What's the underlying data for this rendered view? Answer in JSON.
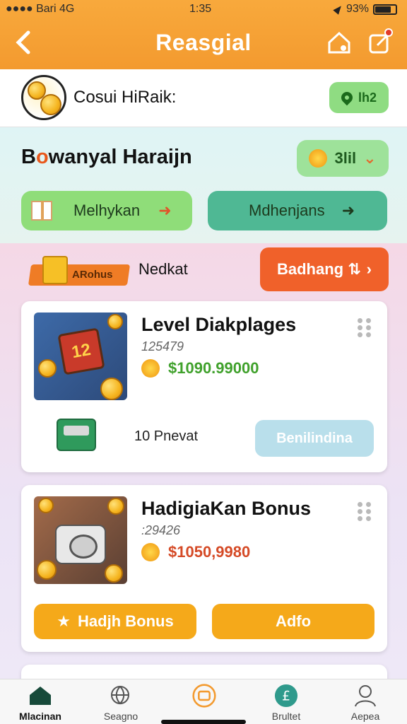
{
  "status_bar": {
    "left": "●●●● Bari 4G",
    "time": "1:35",
    "battery": "93%"
  },
  "header": {
    "title": "Reasgial",
    "back_icon": "chevron-left-icon",
    "home_icon": "home-icon",
    "edit_icon": "edit-icon"
  },
  "profile": {
    "name": "Cosui HiRaik:",
    "badge_label": "lh2"
  },
  "section1": {
    "title_prefix": "B",
    "title_highlight": "o",
    "title_rest": "wanyal Haraijn",
    "pill_label": "3lil",
    "buttons": [
      {
        "label": "Melhykan"
      },
      {
        "label": "Mdhenjans"
      }
    ]
  },
  "section2": {
    "ribbon_label": "ARohus",
    "label": "Nedkat",
    "action_button": "Badhang ⇅"
  },
  "cards": [
    {
      "title": "Level Diakplages",
      "subtitle": "125479",
      "price": "$1090.99000",
      "bottom_label": "10 Pnevat",
      "bottom_button": "Benilindina"
    },
    {
      "title": "HadigiaKan Bonus",
      "subtitle": ":29426",
      "price": "$1050,9980",
      "buttons": [
        "Hadjh Bonus",
        "Adfo"
      ]
    }
  ],
  "nav": [
    {
      "label": "Mlacinan",
      "icon": "home-icon",
      "active": true
    },
    {
      "label": "Seagno",
      "icon": "globe-icon"
    },
    {
      "label": "",
      "icon": "wallet-icon"
    },
    {
      "label": "Brultet",
      "icon": "pound-icon"
    },
    {
      "label": "Aepea",
      "icon": "user-icon"
    }
  ],
  "colors": {
    "header": "#f39a2f",
    "accent_orange": "#f0612a",
    "green": "#8fdd79",
    "teal": "#4fb894",
    "yellow": "#f5a91a"
  }
}
